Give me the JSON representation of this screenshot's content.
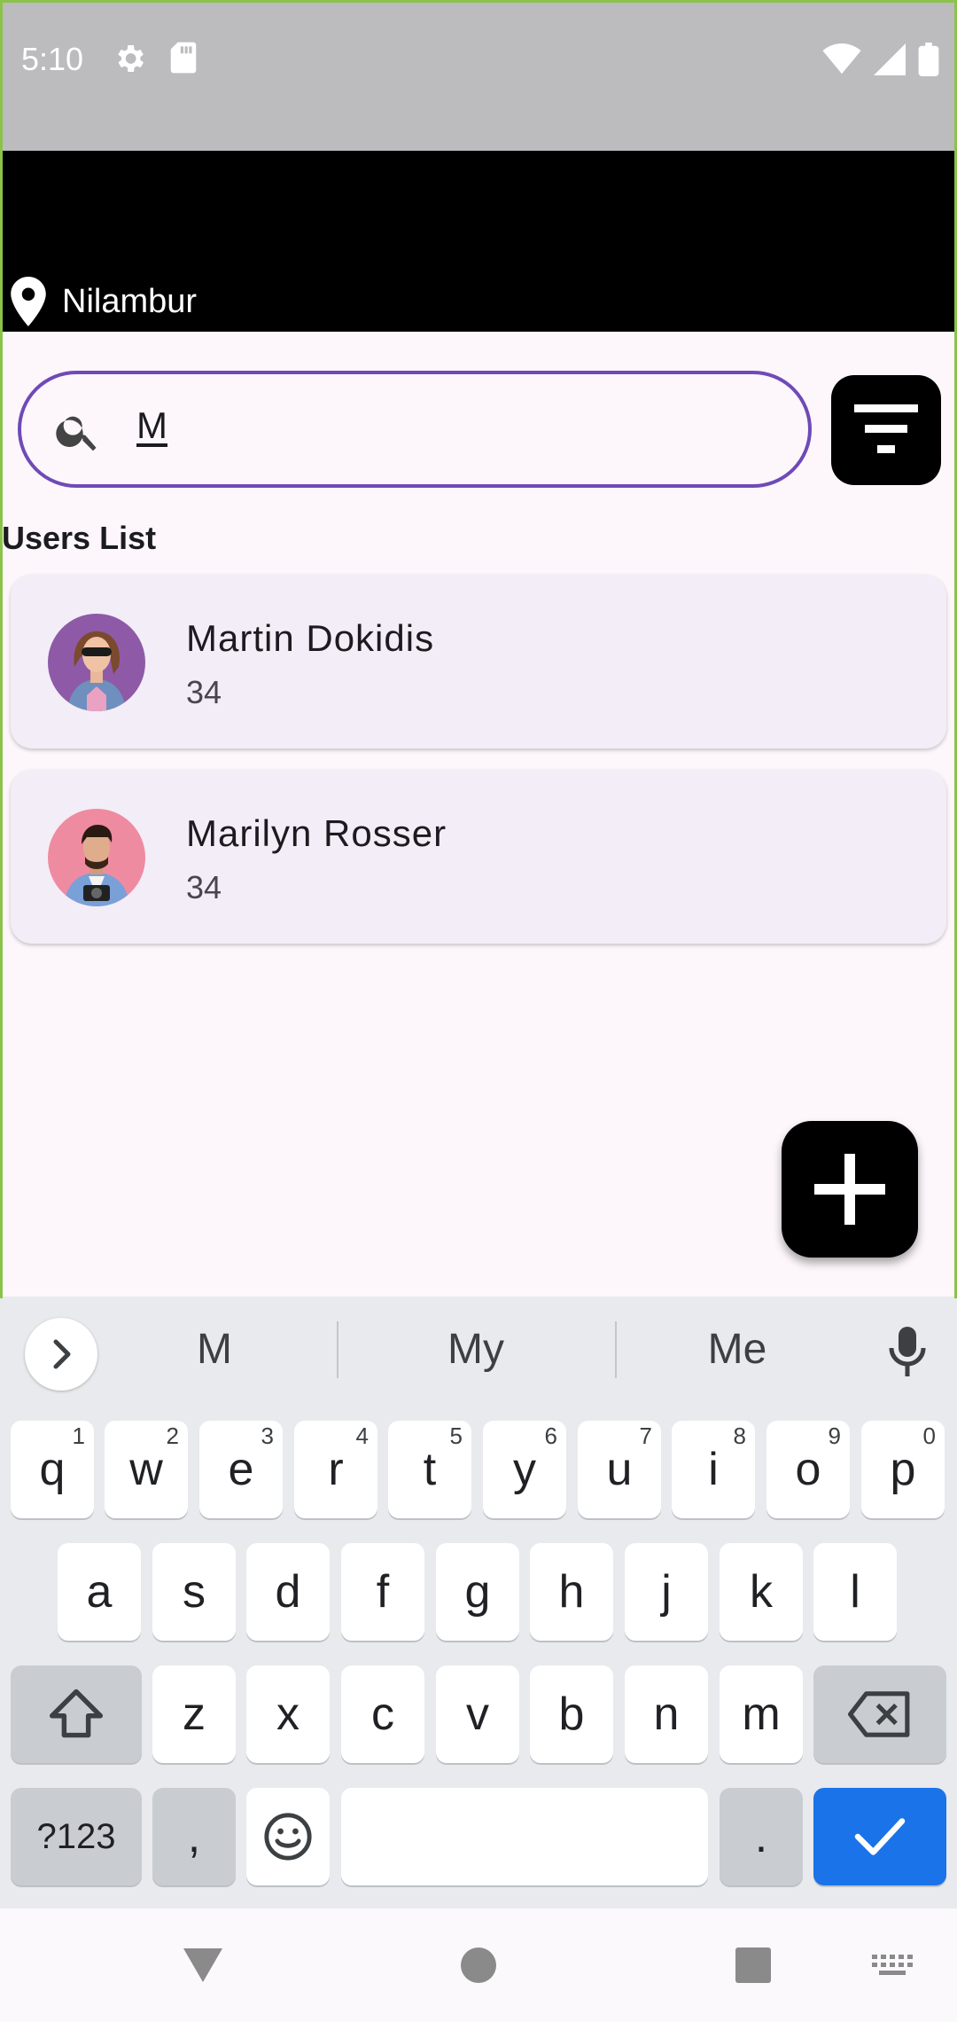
{
  "status_bar": {
    "time": "5:10"
  },
  "header": {
    "location": "Nilambur"
  },
  "search": {
    "value": "M"
  },
  "section_title": "Users List",
  "users": [
    {
      "name": "Martin Dokidis",
      "age": "34"
    },
    {
      "name": "Marilyn Rosser",
      "age": "34"
    }
  ],
  "keyboard": {
    "suggestions": [
      "M",
      "My",
      "Me"
    ],
    "row1": [
      {
        "k": "q",
        "h": "1"
      },
      {
        "k": "w",
        "h": "2"
      },
      {
        "k": "e",
        "h": "3"
      },
      {
        "k": "r",
        "h": "4"
      },
      {
        "k": "t",
        "h": "5"
      },
      {
        "k": "y",
        "h": "6"
      },
      {
        "k": "u",
        "h": "7"
      },
      {
        "k": "i",
        "h": "8"
      },
      {
        "k": "o",
        "h": "9"
      },
      {
        "k": "p",
        "h": "0"
      }
    ],
    "row2": [
      "a",
      "s",
      "d",
      "f",
      "g",
      "h",
      "j",
      "k",
      "l"
    ],
    "row3": [
      "z",
      "x",
      "c",
      "v",
      "b",
      "n",
      "m"
    ],
    "symbols_label": "?123",
    "comma": ",",
    "period": "."
  },
  "colors": {
    "accent": "#6f4ab7",
    "card": "#f3edf7",
    "enter_key": "#1a73e8"
  }
}
